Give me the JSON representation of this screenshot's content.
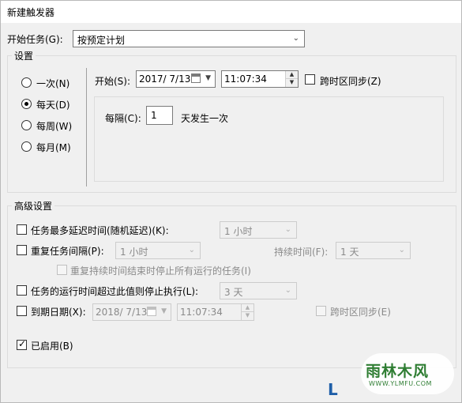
{
  "window": {
    "title": "新建触发器"
  },
  "begin_task": {
    "label": "开始任务(G):",
    "value": "按预定计划"
  },
  "settings": {
    "group_label": "设置",
    "radios": [
      {
        "label": "一次(N)",
        "checked": false
      },
      {
        "label": "每天(D)",
        "checked": true
      },
      {
        "label": "每周(W)",
        "checked": false
      },
      {
        "label": "每月(M)",
        "checked": false
      }
    ],
    "start_label": "开始(S):",
    "start_date": "2017/ 7/13",
    "start_time": "11:07:34",
    "sync_tz_label": "跨时区同步(Z)",
    "every_label": "每隔(C):",
    "every_value": "1",
    "every_suffix": "天发生一次"
  },
  "advanced": {
    "group_label": "高级设置",
    "delay_label": "任务最多延迟时间(随机延迟)(K):",
    "delay_value": "1 小时",
    "repeat_label": "重复任务间隔(P):",
    "repeat_value": "1 小时",
    "duration_label": "持续时间(F):",
    "duration_value": "1 天",
    "stop_running_label": "重复持续时间结束时停止所有运行的任务(I)",
    "stop_if_longer_label": "任务的运行时间超过此值则停止执行(L):",
    "stop_if_longer_value": "3 天",
    "expire_label": "到期日期(X):",
    "expire_date": "2018/ 7/13",
    "expire_time": "11:07:34",
    "expire_sync_label": "跨时区同步(E)",
    "enabled_label": "已启用(B)",
    "enabled_checked": true
  },
  "watermark": {
    "brand": "雨林木风",
    "url": "WWW.YLMFU.COM"
  },
  "colors": {
    "accent": "#2e7d32",
    "disabled_text": "#8a8a8a"
  }
}
